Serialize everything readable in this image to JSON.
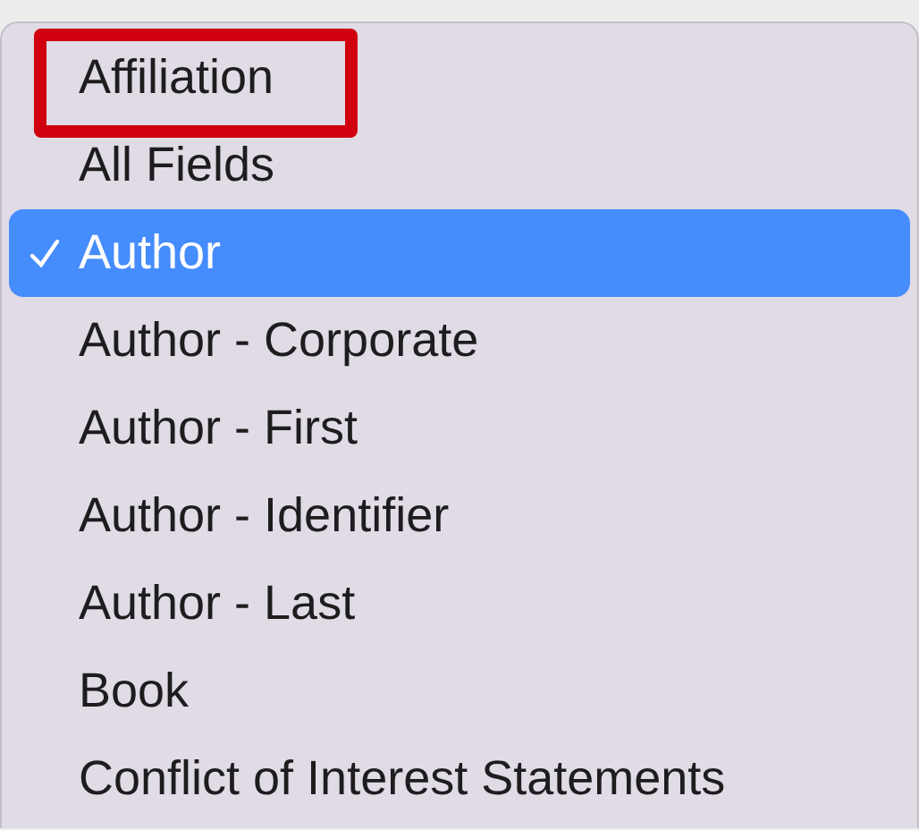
{
  "menu": {
    "items": [
      {
        "label": "Affiliation",
        "selected": false,
        "annotated": true
      },
      {
        "label": "All Fields",
        "selected": false,
        "annotated": false
      },
      {
        "label": "Author",
        "selected": true,
        "annotated": false
      },
      {
        "label": "Author - Corporate",
        "selected": false,
        "annotated": false
      },
      {
        "label": "Author - First",
        "selected": false,
        "annotated": false
      },
      {
        "label": "Author - Identifier",
        "selected": false,
        "annotated": false
      },
      {
        "label": "Author - Last",
        "selected": false,
        "annotated": false
      },
      {
        "label": "Book",
        "selected": false,
        "annotated": false
      },
      {
        "label": "Conflict of Interest Statements",
        "selected": false,
        "annotated": false
      }
    ]
  }
}
